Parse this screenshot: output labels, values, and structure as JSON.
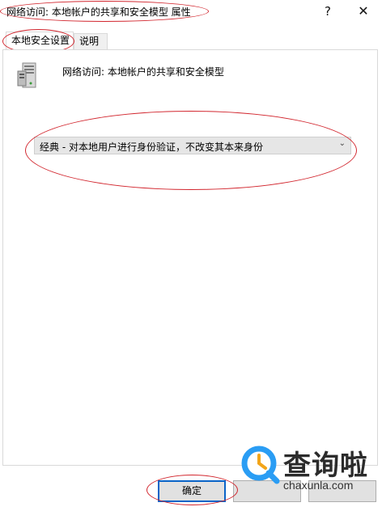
{
  "window": {
    "title": "网络访问: 本地帐户的共享和安全模型 属性",
    "help_glyph": "?",
    "close_glyph": "✕"
  },
  "tabs": [
    {
      "label": "本地安全设置",
      "active": true
    },
    {
      "label": "说明",
      "active": false
    }
  ],
  "policy": {
    "icon": "server-icon",
    "name": "网络访问: 本地帐户的共享和安全模型"
  },
  "dropdown": {
    "selected": "经典 - 对本地用户进行身份验证，不改变其本来身份",
    "arrow_glyph": "⌄"
  },
  "buttons": {
    "ok": "确定",
    "cancel": "",
    "apply": ""
  },
  "watermark": {
    "title": "查询啦",
    "url": "chaxunla.com"
  },
  "colors": {
    "annotation": "#d2262e",
    "ok_border": "#0a64c8",
    "watermark_accent": "#2a9df4"
  }
}
